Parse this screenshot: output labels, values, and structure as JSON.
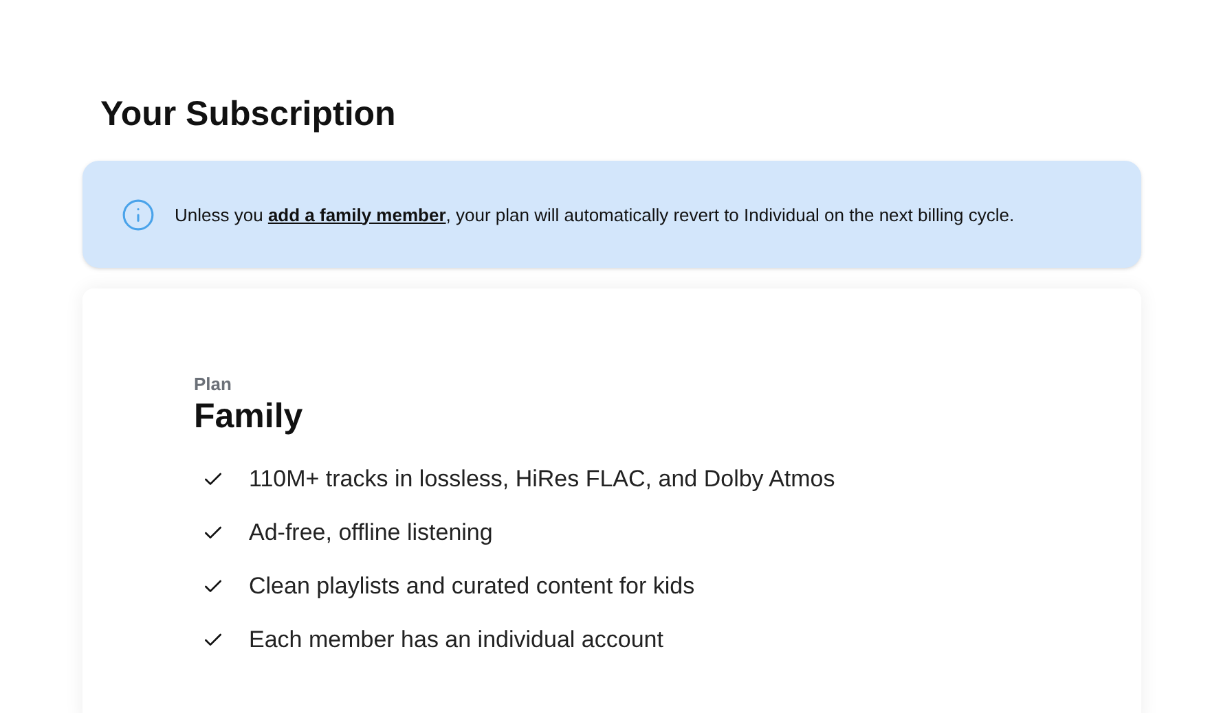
{
  "heading": "Your Subscription",
  "notice": {
    "before": "Unless you",
    "link": "add a family member",
    "after": ", your plan will automatically revert to Individual on the next billing cycle."
  },
  "plan": {
    "label": "Plan",
    "name": "Family",
    "features": [
      "110M+ tracks in lossless, HiRes FLAC, and Dolby Atmos",
      "Ad-free, offline listening",
      "Clean playlists and curated content for kids",
      "Each member has an individual account"
    ]
  }
}
